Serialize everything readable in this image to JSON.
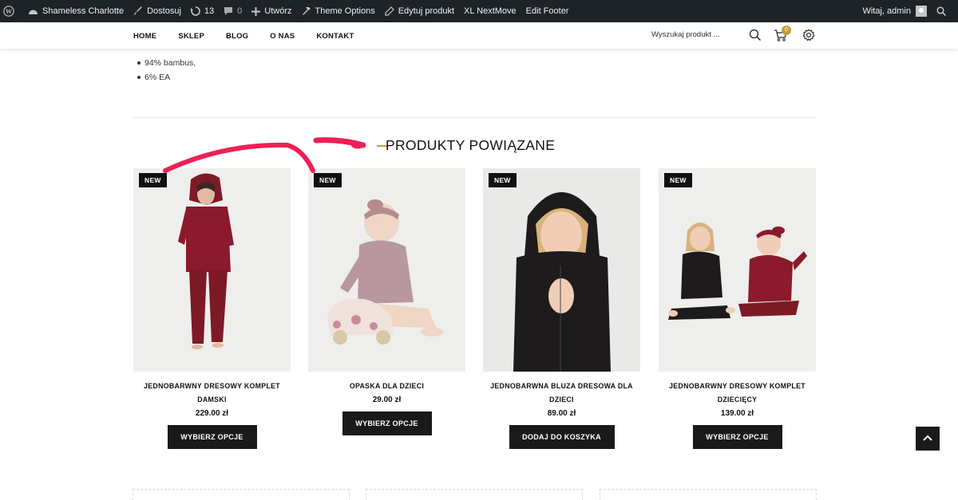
{
  "adminbar": {
    "site_name": "Shameless Charlotte",
    "customize": "Dostosuj",
    "updates_count": "13",
    "comments_count": "0",
    "new": "Utwórz",
    "theme_options": "Theme Options",
    "edit_product": "Edytuj produkt",
    "nextmove": "XL NextMove",
    "edit_footer": "Edit Footer",
    "greeting": "Witaj, admin"
  },
  "nav": {
    "items": [
      "HOME",
      "SKLEP",
      "BLOG",
      "O NAS",
      "KONTAKT"
    ],
    "search_placeholder": "Wyszukaj produkt ...",
    "cart_count": "0"
  },
  "description": {
    "bullets": [
      "94% bambus,",
      "6% EA"
    ]
  },
  "related": {
    "title": "PRODUKTY POWIĄZANE",
    "products": [
      {
        "badge": "NEW",
        "name": "JEDNOBARWNY DRESOWY KOMPLET DAMSKI",
        "price": "229.00 zł",
        "button": "WYBIERZ OPCJE"
      },
      {
        "badge": "NEW",
        "name": "OPASKA DLA DZIECI",
        "price": "29.00 zł",
        "button": "WYBIERZ OPCJE"
      },
      {
        "badge": "NEW",
        "name": "JEDNOBARWNA BLUZA DRESOWA DLA DZIECI",
        "price": "89.00 zł",
        "button": "DODAJ DO KOSZYKA"
      },
      {
        "badge": "NEW",
        "name": "JEDNOBARWNY DRESOWY KOMPLET DZIECIĘCY",
        "price": "139.00 zł",
        "button": "WYBIERZ OPCJE"
      }
    ]
  },
  "colors": {
    "adminbar_bg": "#1d2327",
    "accent_gold": "#c59b3f",
    "button_bg": "#1a1a1a",
    "annotation_red": "#ef1f55"
  }
}
